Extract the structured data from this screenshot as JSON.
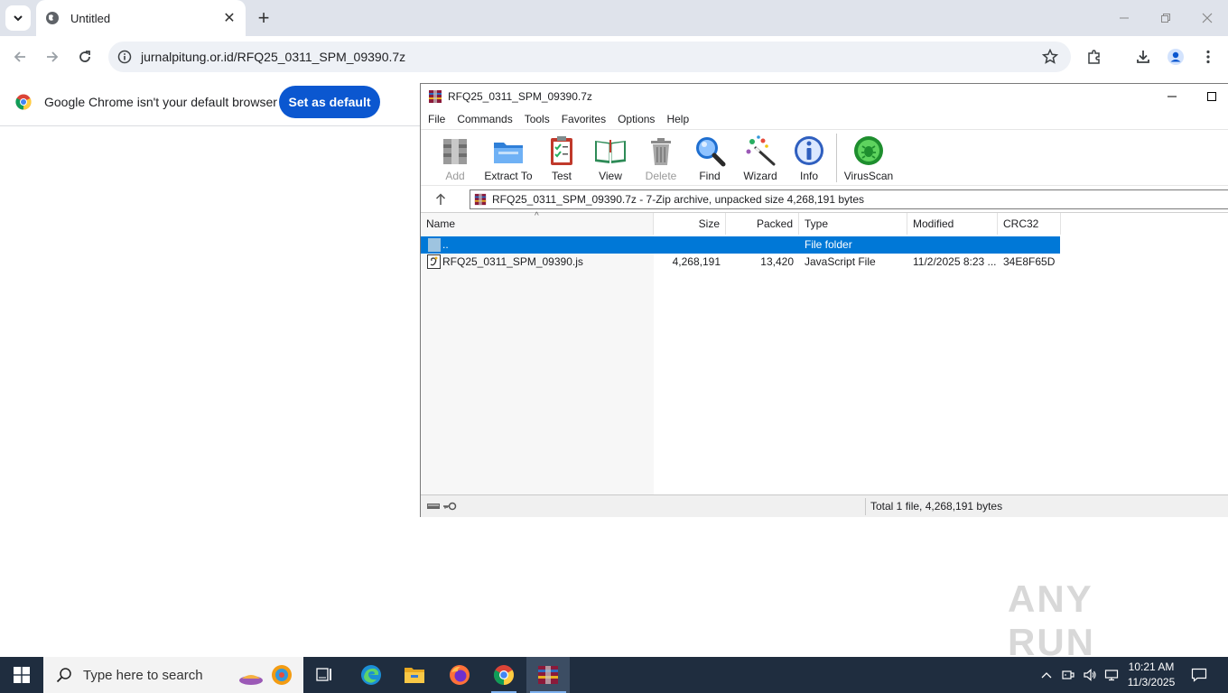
{
  "browser": {
    "tab_title": "Untitled",
    "url": "jurnalpitung.or.id/RFQ25_0311_SPM_09390.7z",
    "infobar_message": "Google Chrome isn't your default browser",
    "set_default_label": "Set as default"
  },
  "winrar": {
    "title": "RFQ25_0311_SPM_09390.7z",
    "menu": [
      "File",
      "Commands",
      "Tools",
      "Favorites",
      "Options",
      "Help"
    ],
    "toolbar": [
      {
        "label": "Add",
        "icon": "add-icon",
        "enabled": false
      },
      {
        "label": "Extract To",
        "icon": "extract-folder-icon",
        "enabled": true
      },
      {
        "label": "Test",
        "icon": "test-clipboard-icon",
        "enabled": true
      },
      {
        "label": "View",
        "icon": "view-book-icon",
        "enabled": true
      },
      {
        "label": "Delete",
        "icon": "trash-icon",
        "enabled": false
      },
      {
        "label": "Find",
        "icon": "magnifier-icon",
        "enabled": true
      },
      {
        "label": "Wizard",
        "icon": "wizard-wand-icon",
        "enabled": true
      },
      {
        "label": "Info",
        "icon": "info-icon",
        "enabled": true
      },
      {
        "label": "VirusScan",
        "icon": "virus-scan-icon",
        "enabled": true
      }
    ],
    "path_text": "RFQ25_0311_SPM_09390.7z - 7-Zip archive, unpacked size 4,268,191 bytes",
    "columns": [
      "Name",
      "Size",
      "Packed",
      "Type",
      "Modified",
      "CRC32"
    ],
    "rows": [
      {
        "name": "..",
        "size": "",
        "packed": "",
        "type": "File folder",
        "modified": "",
        "crc": "",
        "selected": true
      },
      {
        "name": "RFQ25_0311_SPM_09390.js",
        "size": "4,268,191",
        "packed": "13,420",
        "type": "JavaScript File",
        "modified": "11/2/2025 8:23 ...",
        "crc": "34E8F65D",
        "selected": false
      }
    ],
    "status": "Total 1 file, 4,268,191 bytes"
  },
  "watermark": "ANY RUN",
  "taskbar": {
    "search_placeholder": "Type here to search",
    "time": "10:21 AM",
    "date": "11/3/2025"
  },
  "colors": {
    "chrome_tabstrip": "#dfe3eb",
    "set_default_button": "#0b57d0",
    "selection": "#0078d7",
    "taskbar": "#1f2d3f"
  }
}
